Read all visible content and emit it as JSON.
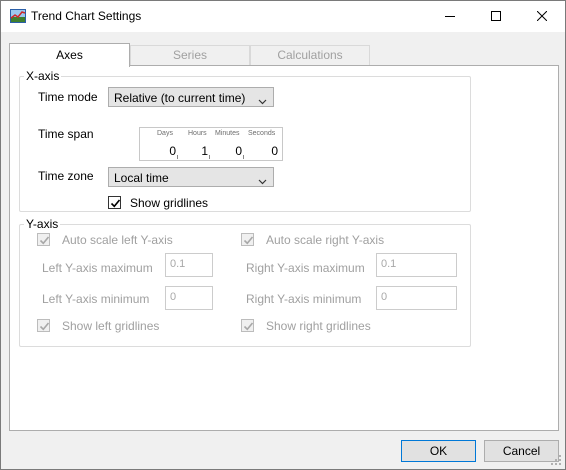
{
  "window": {
    "title": "Trend Chart Settings",
    "icon": "trend-chart-app-icon",
    "controls": [
      "minimize-icon",
      "maximize-icon",
      "close-icon"
    ]
  },
  "tabs": [
    {
      "label": "Axes",
      "active": true
    },
    {
      "label": "Series",
      "active": false
    },
    {
      "label": "Calculations",
      "active": false
    }
  ],
  "x_axis": {
    "legend": "X-axis",
    "time_mode_label": "Time mode",
    "time_mode_value": "Relative (to current time)",
    "time_span_label": "Time span",
    "time_span": {
      "days_label": "Days",
      "days": "0",
      "hours_label": "Hours",
      "hours": "1",
      "minutes_label": "Minutes",
      "minutes": "0",
      "seconds_label": "Seconds",
      "seconds": "0"
    },
    "time_zone_label": "Time zone",
    "time_zone_value": "Local time",
    "show_gridlines_label": "Show gridlines",
    "show_gridlines_checked": true
  },
  "y_axis": {
    "legend": "Y-axis",
    "auto_scale_left_label": "Auto scale left Y-axis",
    "auto_scale_left_checked": true,
    "auto_scale_right_label": "Auto scale right Y-axis",
    "auto_scale_right_checked": true,
    "left_max_label": "Left Y-axis maximum",
    "left_max_placeholder": "0.1",
    "right_max_label": "Right Y-axis maximum",
    "right_max_placeholder": "0.1",
    "left_min_label": "Left Y-axis minimum",
    "left_min_placeholder": "0",
    "right_min_label": "Right Y-axis minimum",
    "right_min_placeholder": "0",
    "show_left_gridlines_label": "Show left gridlines",
    "show_left_gridlines_checked": true,
    "show_right_gridlines_label": "Show right gridlines",
    "show_right_gridlines_checked": true
  },
  "footer": {
    "ok_label": "OK",
    "cancel_label": "Cancel"
  },
  "colors": {
    "accent": "#0078d7",
    "disabled_text": "#a0a0a0",
    "panel": "#ffffff",
    "chrome": "#f0f0f0"
  }
}
